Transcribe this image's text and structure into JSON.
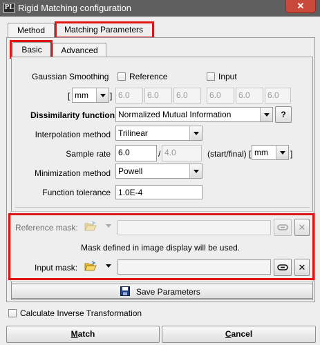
{
  "window": {
    "title": "Rigid Matching configuration",
    "app_icon_text": "PL",
    "close_glyph": "✕"
  },
  "tabs": {
    "method": "Method",
    "matching_parameters": "Matching Parameters"
  },
  "subtabs": {
    "basic": "Basic",
    "advanced": "Advanced"
  },
  "smoothing": {
    "label": "Gaussian Smoothing",
    "reference_label": "Reference",
    "input_label": "Input",
    "bracket_open": "[",
    "bracket_close": "]",
    "unit": "mm",
    "reference_values": [
      "6.0",
      "6.0",
      "6.0"
    ],
    "input_values": [
      "6.0",
      "6.0",
      "6.0"
    ]
  },
  "dissimilarity": {
    "label": "Dissimilarity function",
    "value": "Normalized Mutual Information",
    "help": "?"
  },
  "interpolation": {
    "label": "Interpolation method",
    "value": "Trilinear"
  },
  "sample_rate": {
    "label": "Sample rate",
    "start": "6.0",
    "divider": "/",
    "final": "4.0",
    "suffix": "(start/final) [",
    "unit": "mm",
    "bracket_close": "]"
  },
  "minimization": {
    "label": "Minimization method",
    "value": "Powell"
  },
  "tolerance": {
    "label": "Function tolerance",
    "value": "1.0E-4"
  },
  "mask": {
    "reference_label": "Reference mask:",
    "note": "Mask defined in image display will be used.",
    "input_label": "Input mask:",
    "input_value": "",
    "reference_value": "",
    "clear_glyph": "✕"
  },
  "save_button": "Save Parameters",
  "inverse_label": "Calculate Inverse Transformation",
  "buttons": {
    "match_mnemonic": "M",
    "match_rest": "atch",
    "cancel_mnemonic": "C",
    "cancel_rest": "ancel"
  },
  "colors": {
    "highlight": "#e01414",
    "titlebar": "#5f5f5f",
    "close_button": "#c94a3b",
    "folder_icon": "#f0c030"
  }
}
